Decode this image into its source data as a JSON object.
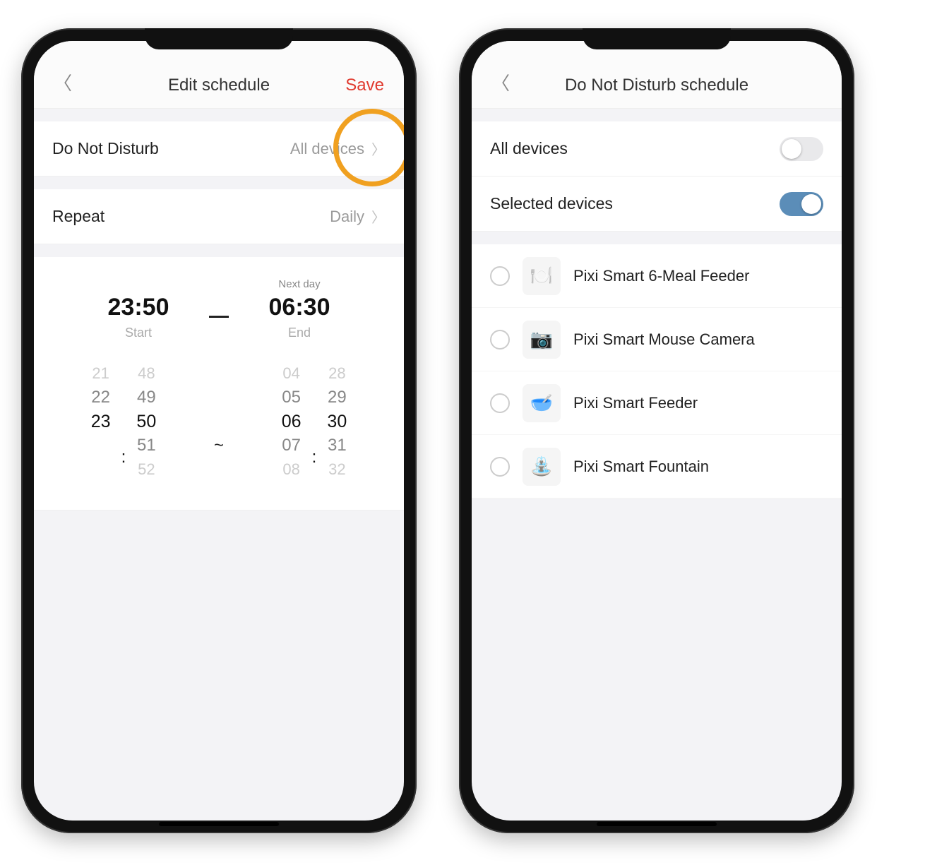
{
  "phone1": {
    "header": {
      "title": "Edit schedule",
      "save": "Save"
    },
    "dnd_row": {
      "label": "Do Not Disturb",
      "value": "All devices"
    },
    "repeat_row": {
      "label": "Repeat",
      "value": "Daily"
    },
    "time": {
      "start_time": "23:50",
      "start_label": "Start",
      "end_time": "06:30",
      "end_label": "End",
      "next_day": "Next day"
    },
    "picker": {
      "start_hours": [
        "21",
        "22",
        "23",
        "",
        ""
      ],
      "start_mins": [
        "48",
        "49",
        "50",
        "51",
        "52"
      ],
      "end_hours": [
        "04",
        "05",
        "06",
        "07",
        "08"
      ],
      "end_mins": [
        "28",
        "29",
        "30",
        "31",
        "32"
      ]
    }
  },
  "phone2": {
    "header": {
      "title": "Do Not Disturb schedule"
    },
    "all_devices": {
      "label": "All devices",
      "on": false
    },
    "selected_devices": {
      "label": "Selected devices",
      "on": true
    },
    "devices": [
      {
        "name": "Pixi Smart 6-Meal Feeder"
      },
      {
        "name": "Pixi Smart Mouse Camera"
      },
      {
        "name": "Pixi Smart Feeder"
      },
      {
        "name": "Pixi Smart Fountain"
      }
    ]
  }
}
